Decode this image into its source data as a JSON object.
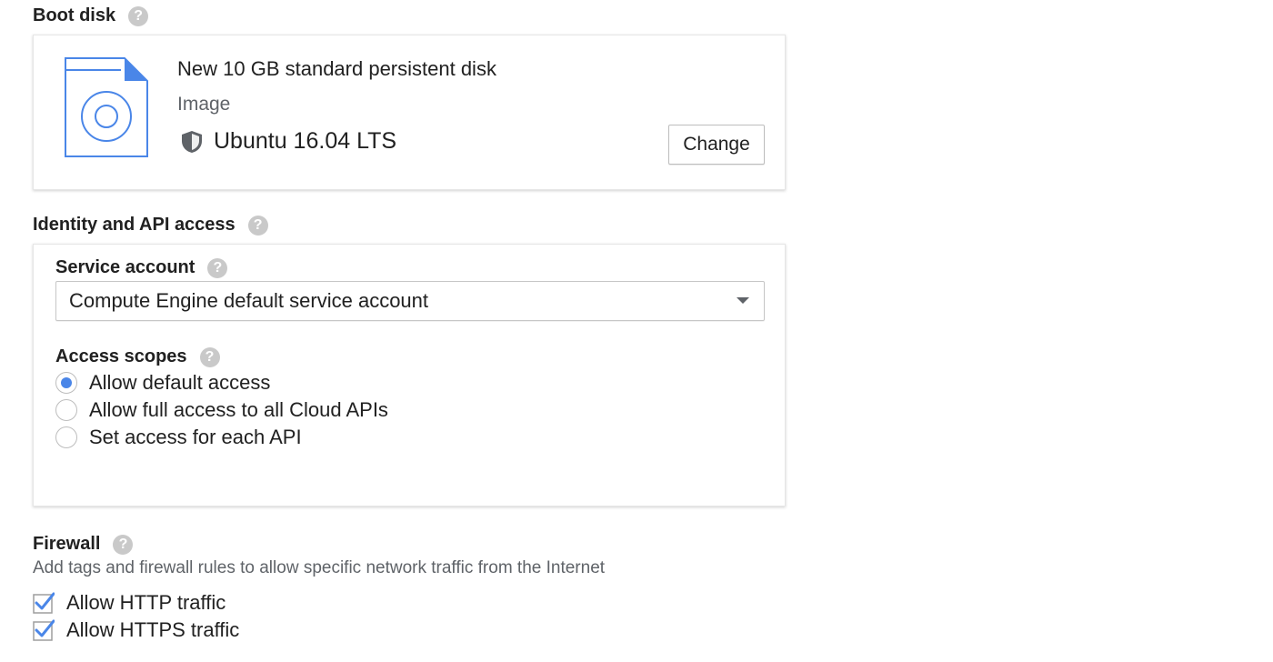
{
  "boot_disk": {
    "title": "Boot disk",
    "disk_name": "New 10 GB standard persistent disk",
    "image_label": "Image",
    "os_name": "Ubuntu 16.04 LTS",
    "change_label": "Change"
  },
  "identity": {
    "title": "Identity and API access",
    "service_account_label": "Service account",
    "service_account_value": "Compute Engine default service account",
    "access_scopes_label": "Access scopes",
    "scopes": [
      {
        "label": "Allow default access",
        "selected": true
      },
      {
        "label": "Allow full access to all Cloud APIs",
        "selected": false
      },
      {
        "label": "Set access for each API",
        "selected": false
      }
    ]
  },
  "firewall": {
    "title": "Firewall",
    "description": "Add tags and firewall rules to allow specific network traffic from the Internet",
    "options": [
      {
        "label": "Allow HTTP traffic",
        "checked": true
      },
      {
        "label": "Allow HTTPS traffic",
        "checked": true
      }
    ]
  },
  "icons": {
    "help": "?"
  },
  "colors": {
    "accent": "#4a86e8",
    "help_icon": "#c9c9c9",
    "secondary_text": "#5f6368"
  }
}
